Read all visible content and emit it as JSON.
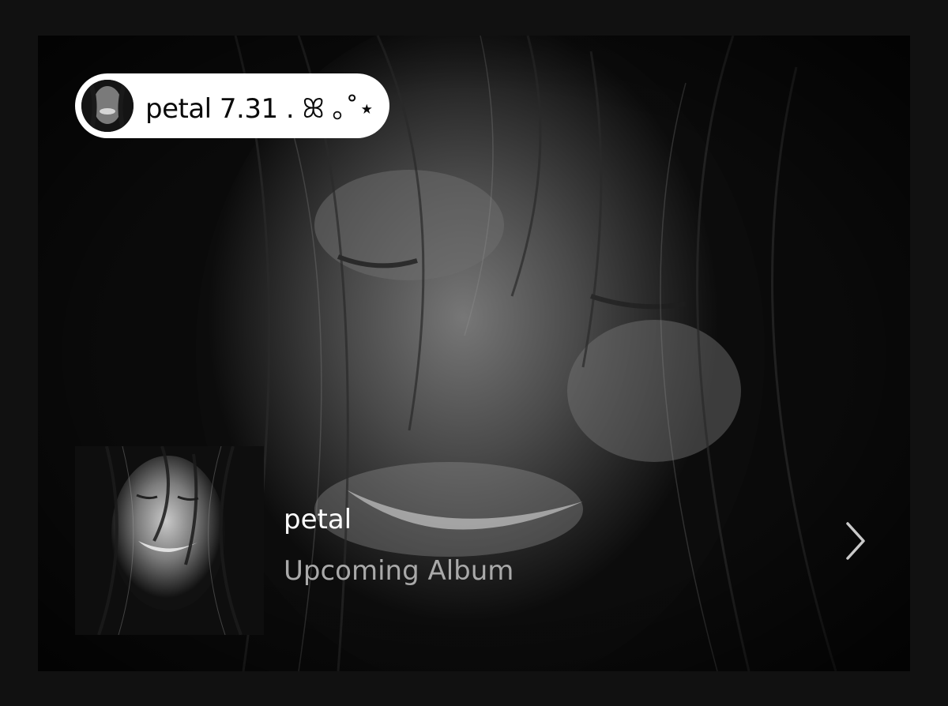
{
  "pill": {
    "title": "petal 7.31 . ꕤ ｡˚⋆",
    "avatar_icon": "artist-avatar-photo"
  },
  "album": {
    "cover_icon": "album-cover-photo",
    "title": "petal",
    "subtitle": "Upcoming Album"
  },
  "navigation": {
    "forward_icon": "chevron-right-icon"
  },
  "colors": {
    "page_background": "#111111",
    "pill_background": "#ffffff",
    "title_text": "#ffffff",
    "subtitle_text": "#a9a9a9"
  }
}
